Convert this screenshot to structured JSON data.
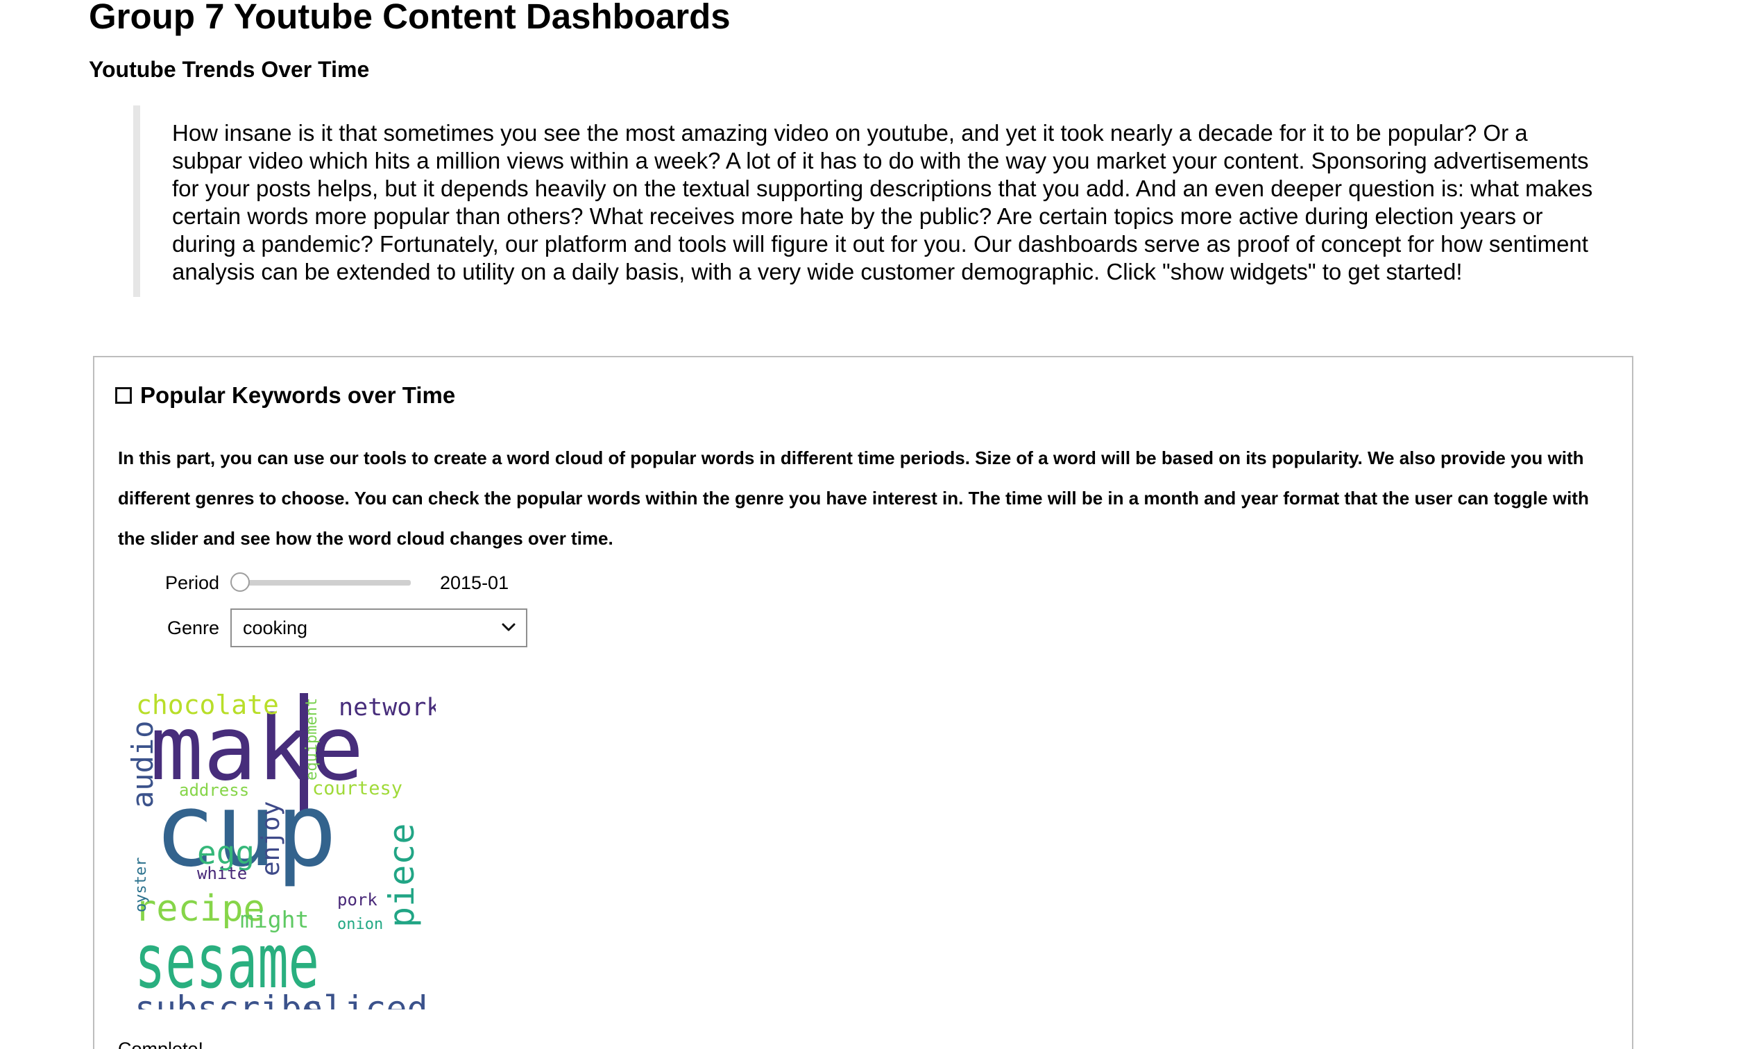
{
  "page": {
    "title": "Group 7 Youtube Content Dashboards",
    "subtitle": "Youtube Trends Over Time",
    "intro": "How insane is it that sometimes you see the most amazing video on youtube, and yet it took nearly a decade for it to be popular? Or a subpar video which hits a million views within a week? A lot of it has to do with the way you market your content. Sponsoring advertisements for your posts helps, but it depends heavily on the textual supporting descriptions that you add. And an even deeper question is: what makes certain words more popular than others? What receives more hate by the public? Are certain topics more active during election years or during a pandemic? Fortunately, our platform and tools will figure it out for you. Our dashboards serve as proof of concept for how sentiment analysis can be extended to utility on a daily basis, with a very wide customer demographic. Click \"show widgets\" to get started!"
  },
  "panel": {
    "title": "Popular Keywords over Time",
    "description": "In this part, you can use our tools to create a word cloud of popular words in different time periods. Size of a word will be based on its popularity. We also provide you with different genres to choose. You can check the popular words within the genre you have interest in. The time will be in a month and year format that the user can toggle with the slider and see how the word cloud changes over time.",
    "period": {
      "label": "Period",
      "value": "2015-01",
      "position_fraction": 0
    },
    "genre": {
      "label": "Genre",
      "value": "cooking"
    },
    "wordcloud": {
      "words": [
        {
          "text": "make",
          "color": "#472d7b"
        },
        {
          "text": "cup",
          "color": "#33638d"
        },
        {
          "text": "sesame",
          "color": "#29af7f"
        },
        {
          "text": "subscribe",
          "color": "#3b528b"
        },
        {
          "text": "sliced",
          "color": "#3b528b"
        },
        {
          "text": "recipe",
          "color": "#86d549"
        },
        {
          "text": "chocolate",
          "color": "#b8de29"
        },
        {
          "text": "network",
          "color": "#472d7b"
        },
        {
          "text": "audio",
          "color": "#3b528b"
        },
        {
          "text": "piece",
          "color": "#21a585"
        },
        {
          "text": "enjoy",
          "color": "#3e4a89"
        },
        {
          "text": "egg",
          "color": "#35b779"
        },
        {
          "text": "white",
          "color": "#482878"
        },
        {
          "text": "might",
          "color": "#5ec962"
        },
        {
          "text": "address",
          "color": "#86d549"
        },
        {
          "text": "courtesy",
          "color": "#a0da39"
        },
        {
          "text": "equipment",
          "color": "#7ad151"
        },
        {
          "text": "oyster",
          "color": "#2c728e"
        },
        {
          "text": "pork",
          "color": "#482878"
        },
        {
          "text": "onion",
          "color": "#22a884"
        }
      ],
      "extra_bar_color": "#472d7b"
    },
    "status": "Complete!"
  }
}
